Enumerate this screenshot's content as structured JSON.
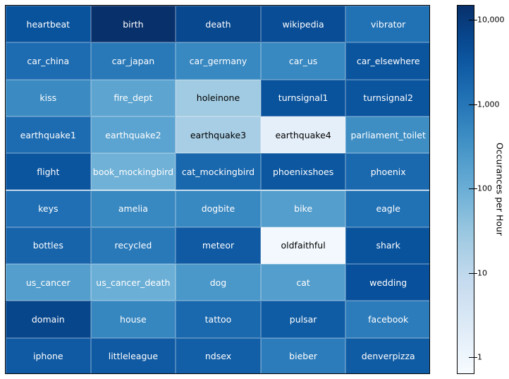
{
  "chart_data": {
    "type": "heatmap",
    "colormap": "Blues",
    "scale": "log",
    "clim": [
      0.63,
      15000
    ],
    "colorbar_label": "Occurances per Hour",
    "colorbar_ticks": [
      {
        "value": 10000,
        "label": "10,000"
      },
      {
        "value": 1000,
        "label": "1,000"
      },
      {
        "value": 100,
        "label": "100"
      },
      {
        "value": 10,
        "label": "10"
      },
      {
        "value": 1,
        "label": "1"
      }
    ],
    "rows": [
      [
        {
          "label": "heartbeat",
          "value": 4000
        },
        {
          "label": "birth",
          "value": 15000
        },
        {
          "label": "death",
          "value": 6000
        },
        {
          "label": "wikipedia",
          "value": 5000
        },
        {
          "label": "vibrator",
          "value": 1200
        }
      ],
      [
        {
          "label": "car_china",
          "value": 1500
        },
        {
          "label": "car_japan",
          "value": 900
        },
        {
          "label": "car_germany",
          "value": 500
        },
        {
          "label": "car_us",
          "value": 500
        },
        {
          "label": "car_elsewhere",
          "value": 3700
        }
      ],
      [
        {
          "label": "kiss",
          "value": 450
        },
        {
          "label": "fire_dept",
          "value": 150
        },
        {
          "label": "holeinone",
          "value": 25
        },
        {
          "label": "turnsignal1",
          "value": 4000
        },
        {
          "label": "turnsignal2",
          "value": 3600
        }
      ],
      [
        {
          "label": "earthquake1",
          "value": 1500
        },
        {
          "label": "earthquake2",
          "value": 160
        },
        {
          "label": "earthquake3",
          "value": 20
        },
        {
          "label": "earthquake4",
          "value": 1.6
        },
        {
          "label": "parliament_toilet",
          "value": 400
        }
      ],
      [
        {
          "label": "flight",
          "value": 3700
        },
        {
          "label": "book_mockingbird",
          "value": 85
        },
        {
          "label": "cat_mockingbird",
          "value": 1800
        },
        {
          "label": "phoenixshoes",
          "value": 3400
        },
        {
          "label": "phoenix",
          "value": 1700
        }
      ],
      [
        {
          "label": "keys",
          "value": 1300
        },
        {
          "label": "amelia",
          "value": 500
        },
        {
          "label": "dogbite",
          "value": 500
        },
        {
          "label": "bike",
          "value": 200
        },
        {
          "label": "eagle",
          "value": 1200
        }
      ],
      [
        {
          "label": "bottles",
          "value": 2000
        },
        {
          "label": "recycled",
          "value": 900
        },
        {
          "label": "meteor",
          "value": 3000
        },
        {
          "label": "oldfaithful",
          "value": 0.8
        },
        {
          "label": "shark",
          "value": 4000
        }
      ],
      [
        {
          "label": "us_cancer",
          "value": 200
        },
        {
          "label": "us_cancer_death",
          "value": 95
        },
        {
          "label": "dog",
          "value": 270
        },
        {
          "label": "cat",
          "value": 200
        },
        {
          "label": "wedding",
          "value": 4400
        }
      ],
      [
        {
          "label": "domain",
          "value": 6500
        },
        {
          "label": "house",
          "value": 550
        },
        {
          "label": "tattoo",
          "value": 1700
        },
        {
          "label": "pulsar",
          "value": 2800
        },
        {
          "label": "facebook",
          "value": 800
        }
      ],
      [
        {
          "label": "iphone",
          "value": 3000
        },
        {
          "label": "littleleague",
          "value": 3000
        },
        {
          "label": "ndsex",
          "value": 2500
        },
        {
          "label": "bieber",
          "value": 800
        },
        {
          "label": "denverpizza",
          "value": 2800
        }
      ]
    ]
  }
}
